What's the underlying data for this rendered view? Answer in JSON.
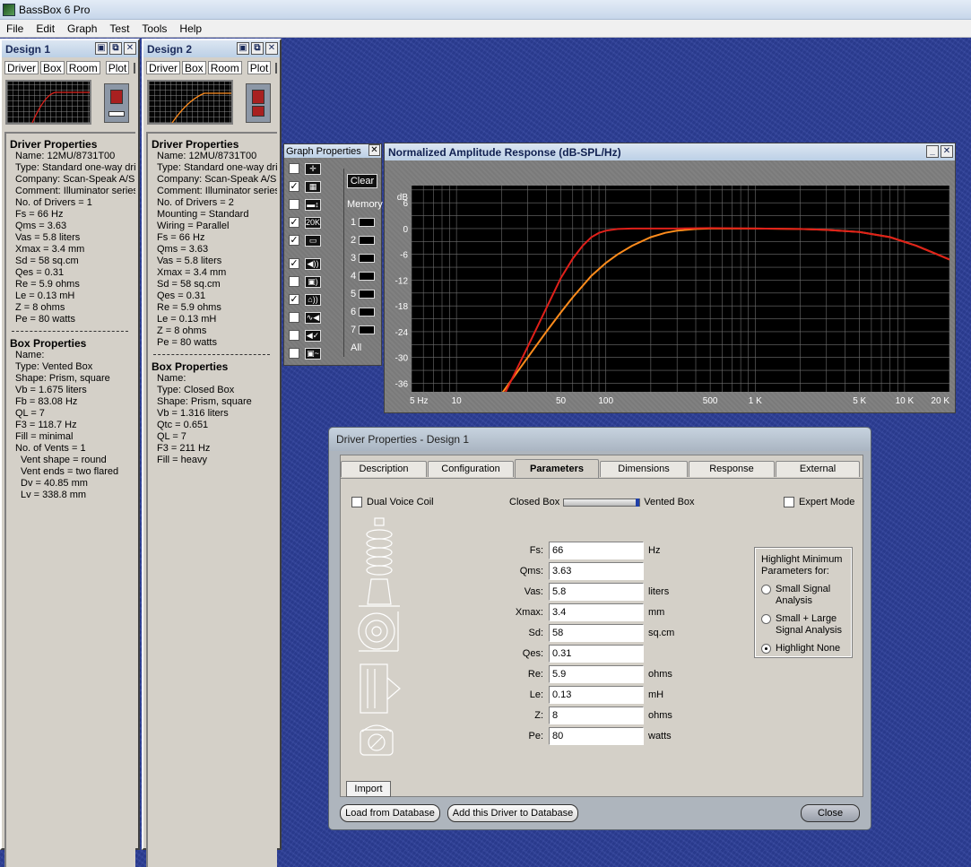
{
  "app": {
    "title": "BassBox 6 Pro"
  },
  "menu": [
    "File",
    "Edit",
    "Graph",
    "Test",
    "Tools",
    "Help"
  ],
  "designs": [
    {
      "title": "Design 1",
      "tabs": [
        "Driver",
        "Box",
        "Room"
      ],
      "plot_label": "Plot",
      "swatch_color": "#ff2a10",
      "driver_heading": "Driver Properties",
      "driver_lines": [
        "Name: 12MU/8731T00",
        "Type: Standard one-way driver",
        "Company: Scan-Speak A/S",
        "Comment: Illuminator series",
        "No. of Drivers = 1",
        "Fs = 66 Hz",
        "Qms = 3.63",
        "Vas = 5.8 liters",
        "Xmax = 3.4 mm",
        "Sd = 58 sq.cm",
        "Qes = 0.31",
        "Re = 5.9 ohms",
        "Le = 0.13 mH",
        "Z = 8 ohms",
        "Pe = 80 watts"
      ],
      "box_heading": "Box Properties",
      "box_lines": [
        "Name:",
        "Type: Vented Box",
        "Shape: Prism, square",
        "Vb = 1.675 liters",
        "Fb = 83.08 Hz",
        "QL = 7",
        "F3 = 118.7 Hz",
        "Fill = minimal",
        "No. of Vents = 1"
      ],
      "vent_lines": [
        "Vent shape = round",
        "Vent ends = two flared",
        "Dv = 40.85 mm",
        "Lv = 338.8 mm"
      ]
    },
    {
      "title": "Design 2",
      "tabs": [
        "Driver",
        "Box",
        "Room"
      ],
      "plot_label": "Plot",
      "swatch_color": "#ff8a10",
      "driver_heading": "Driver Properties",
      "driver_lines": [
        "Name: 12MU/8731T00",
        "Type: Standard one-way driver",
        "Company: Scan-Speak A/S",
        "Comment: Illuminator series",
        "No. of Drivers = 2",
        "Mounting = Standard",
        "Wiring = Parallel",
        "Fs = 66 Hz",
        "Qms = 3.63",
        "Vas = 5.8 liters",
        "Xmax = 3.4 mm",
        "Sd = 58 sq.cm",
        "Qes = 0.31",
        "Re = 5.9 ohms",
        "Le = 0.13 mH",
        "Z = 8 ohms",
        "Pe = 80 watts"
      ],
      "box_heading": "Box Properties",
      "box_lines": [
        "Name:",
        "Type: Closed Box",
        "Shape: Prism, square",
        "Vb = 1.316 liters",
        "Qtc = 0.651",
        "QL = 7",
        "F3 = 211 Hz",
        "Fill = heavy"
      ],
      "vent_lines": []
    }
  ],
  "graph_properties": {
    "title": "Graph Properties",
    "clear_label": "Clear",
    "memory_label": "Memory",
    "memory_slots": [
      "1",
      "2",
      "3",
      "4",
      "5",
      "6",
      "7"
    ],
    "all_label": "All",
    "rows": [
      {
        "icon": "crosshair-icon",
        "checked": false,
        "glyph": "✛"
      },
      {
        "icon": "grid-icon",
        "checked": true,
        "glyph": "▦"
      },
      {
        "icon": "vertical-scale-icon",
        "checked": false,
        "glyph": "▬↕"
      },
      {
        "icon": "frequency-20k-icon",
        "checked": true,
        "glyph": "20K"
      },
      {
        "icon": "trace-icon",
        "checked": true,
        "glyph": "▭"
      },
      {
        "icon": "speaker-anechoic-icon",
        "checked": true,
        "glyph": "◀))"
      },
      {
        "icon": "box-response-icon",
        "checked": false,
        "glyph": "▣)"
      },
      {
        "icon": "room-response-icon",
        "checked": true,
        "glyph": "⌂))"
      },
      {
        "icon": "crossover-icon",
        "checked": false,
        "glyph": "∿◀"
      },
      {
        "icon": "speaker-eq-icon",
        "checked": false,
        "glyph": "◀✓"
      },
      {
        "icon": "box-eq-icon",
        "checked": false,
        "glyph": "▣~"
      }
    ]
  },
  "graph": {
    "title": "Normalized Amplitude Response (dB-SPL/Hz)",
    "colors": {
      "design1": "#e0201a",
      "design2": "#ff8c1c",
      "grid": "#6f6f6f",
      "background": "#000000"
    }
  },
  "chart_data": {
    "type": "line",
    "title": "Normalized Amplitude Response (dB-SPL/Hz)",
    "ylabel": "dB",
    "xlabel": "",
    "x_scale": "log",
    "xlim": [
      5,
      20000
    ],
    "ylim": [
      -38,
      10
    ],
    "y_ticks": [
      6,
      0,
      -6,
      -12,
      -18,
      -24,
      -30,
      -36
    ],
    "x_tick_labels": [
      {
        "value": 5,
        "label": "5 Hz"
      },
      {
        "value": 10,
        "label": "10"
      },
      {
        "value": 50,
        "label": "50"
      },
      {
        "value": 100,
        "label": "100"
      },
      {
        "value": 500,
        "label": "500"
      },
      {
        "value": 1000,
        "label": "1 K"
      },
      {
        "value": 5000,
        "label": "5 K"
      },
      {
        "value": 10000,
        "label": "10 K"
      },
      {
        "value": 20000,
        "label": "20 K"
      }
    ],
    "grid": true,
    "series": [
      {
        "x": [
          20,
          30,
          40,
          50,
          60,
          70,
          80,
          90,
          100,
          120,
          150,
          200,
          300,
          500,
          1000,
          2000,
          3000,
          5000,
          8000,
          12000,
          16000,
          20000
        ],
        "y": [
          -40,
          -27.5,
          -18.5,
          -11.5,
          -7,
          -4,
          -2,
          -1,
          -0.5,
          -0.1,
          0,
          0,
          0,
          0.1,
          0,
          -0.1,
          -0.3,
          -0.8,
          -2,
          -4,
          -5.8,
          -7.2
        ]
      },
      {
        "x": [
          20,
          30,
          40,
          50,
          60,
          80,
          100,
          120,
          150,
          200,
          250,
          300,
          400,
          500,
          1000,
          2000,
          3000,
          5000,
          8000,
          12000,
          16000,
          20000
        ],
        "y": [
          -38.5,
          -30,
          -24,
          -19.5,
          -16,
          -11,
          -8,
          -6,
          -4,
          -2,
          -1,
          -0.5,
          -0.1,
          0,
          0,
          -0.1,
          -0.3,
          -0.8,
          -2,
          -4,
          -5.8,
          -7.2
        ]
      }
    ]
  },
  "dialog": {
    "title": "Driver Properties - Design 1",
    "tabs": [
      "Description",
      "Configuration",
      "Parameters",
      "Dimensions",
      "Response",
      "External"
    ],
    "active_tab": "Parameters",
    "dual_voice_coil_label": "Dual Voice Coil",
    "closed_box_label": "Closed Box",
    "vented_box_label": "Vented Box",
    "expert_mode_label": "Expert Mode",
    "fields": [
      {
        "label": "Fs:",
        "value": "66",
        "unit": "Hz"
      },
      {
        "label": "Qms:",
        "value": "3.63",
        "unit": ""
      },
      {
        "label": "Vas:",
        "value": "5.8",
        "unit": "liters"
      },
      {
        "label": "Xmax:",
        "value": "3.4",
        "unit": "mm"
      },
      {
        "label": "Sd:",
        "value": "58",
        "unit": "sq.cm"
      },
      {
        "label": "Qes:",
        "value": "0.31",
        "unit": ""
      },
      {
        "label": "Re:",
        "value": "5.9",
        "unit": "ohms"
      },
      {
        "label": "Le:",
        "value": "0.13",
        "unit": "mH"
      },
      {
        "label": "Z:",
        "value": "8",
        "unit": "ohms"
      },
      {
        "label": "Pe:",
        "value": "80",
        "unit": "watts"
      }
    ],
    "highlight": {
      "title": "Highlight Minimum Parameters for:",
      "options": [
        "Small Signal Analysis",
        "Small + Large Signal Analysis",
        "Highlight None"
      ],
      "selected": "Highlight None"
    },
    "import_label": "Import",
    "load_db_label": "Load from Database",
    "add_db_label": "Add this Driver to Database",
    "close_label": "Close"
  }
}
